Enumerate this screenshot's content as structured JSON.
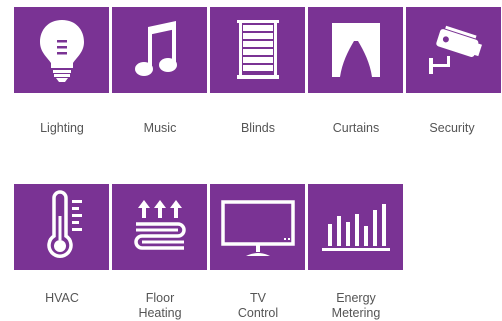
{
  "colors": {
    "tile": "#7a3394",
    "icon": "#ffffff",
    "label": "#555555"
  },
  "tiles": [
    {
      "label": "Lighting",
      "icon": "lightbulb-icon"
    },
    {
      "label": "Music",
      "icon": "music-note-icon"
    },
    {
      "label": "Blinds",
      "icon": "blinds-icon"
    },
    {
      "label": "Curtains",
      "icon": "curtains-icon"
    },
    {
      "label": "Security",
      "icon": "security-camera-icon"
    },
    {
      "label": "HVAC",
      "icon": "thermometer-icon"
    },
    {
      "label": "Floor\nHeating",
      "icon": "floor-heating-icon"
    },
    {
      "label": "TV\nControl",
      "icon": "tv-icon"
    },
    {
      "label": "Energy\nMetering",
      "icon": "energy-meter-icon"
    }
  ]
}
